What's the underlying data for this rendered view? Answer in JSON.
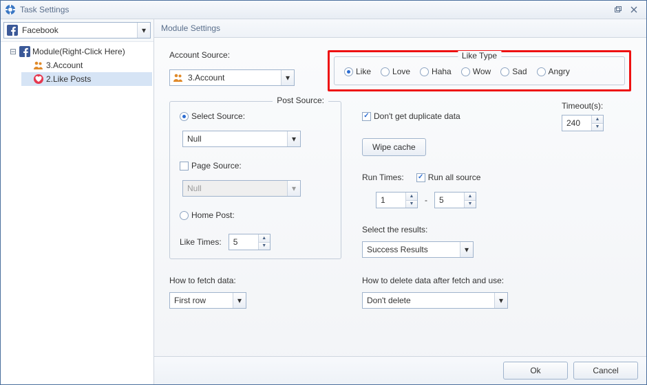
{
  "window": {
    "title": "Task Settings"
  },
  "sidebar": {
    "combo": {
      "label": "Facebook"
    },
    "tree": {
      "root": "Module(Right-Click Here)",
      "children": [
        {
          "label": "3.Account"
        },
        {
          "label": "2.Like Posts"
        }
      ]
    }
  },
  "main": {
    "header": "Module Settings",
    "account_source_label": "Account Source:",
    "account_source_value": "3.Account",
    "like_type": {
      "legend": "Like Type",
      "options": [
        "Like",
        "Love",
        "Haha",
        "Wow",
        "Sad",
        "Angry"
      ],
      "selected": "Like"
    },
    "post_source": {
      "legend": "Post Source:",
      "select_source_label": "Select Source:",
      "select_source_value": "Null",
      "page_source_label": "Page Source:",
      "page_source_value": "Null",
      "home_post_label": "Home Post:",
      "like_times_label": "Like Times:",
      "like_times_value": "5"
    },
    "dup_label": "Don't get duplicate data",
    "timeout_label": "Timeout(s):",
    "timeout_value": "240",
    "wipe_cache": "Wipe cache",
    "run_times_label": "Run Times:",
    "run_all_source_label": "Run all source",
    "run_from": "1",
    "run_to": "5",
    "select_results_label": "Select the results:",
    "select_results_value": "Success Results",
    "fetch_label": "How to fetch data:",
    "fetch_value": "First row",
    "delete_label": "How to delete data after fetch and use:",
    "delete_value": "Don't delete"
  },
  "footer": {
    "ok": "Ok",
    "cancel": "Cancel"
  }
}
